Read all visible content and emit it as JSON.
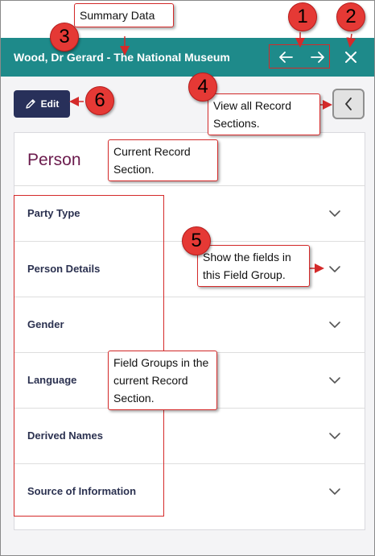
{
  "header": {
    "title": "Wood, Dr Gerard - The National Museum",
    "background": "#1e8a8a",
    "prev_icon": "arrow-left-icon",
    "next_icon": "arrow-right-icon",
    "close_icon": "close-icon"
  },
  "toolbar": {
    "edit_label": "Edit",
    "edit_icon": "pencil-icon",
    "sections_icon": "chevron-left-icon"
  },
  "record_section": {
    "title": "Person",
    "title_color": "#6b1b4d",
    "field_groups": [
      {
        "label": "Party Type"
      },
      {
        "label": "Person Details"
      },
      {
        "label": "Gender"
      },
      {
        "label": "Language"
      },
      {
        "label": "Derived Names"
      },
      {
        "label": "Source of Information"
      }
    ]
  },
  "annotations": {
    "badges": [
      "1",
      "2",
      "3",
      "4",
      "5",
      "6"
    ],
    "callouts": {
      "summary_data": "Summary Data",
      "view_sections": "View all Record Sections.",
      "current_section": "Current Record Section.",
      "show_fields": "Show the fields in this Field Group.",
      "field_groups": "Field Groups in the current Record Section."
    },
    "color": "#d42a2a"
  }
}
